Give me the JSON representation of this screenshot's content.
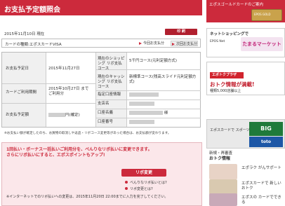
{
  "page": {
    "title": "お支払予定額照会",
    "date_text": "2015年11月10日 現在",
    "print_button": "印 刷",
    "card_type": "カードの種類:エポスカードVISA",
    "tab_current": "今回お支払分",
    "tab_next": "次回お支払分"
  },
  "info": {
    "due_date_label": "お支払予定日",
    "due_date_value": "2015年11月27日",
    "usage_period_label": "カードご利用期間",
    "usage_period_value": "2015年10月27日 まで ご利用分",
    "amount_label": "お支払予定額",
    "amount_suffix": "円(確定)",
    "shopping_course_label": "現在のショッピング リボ支払コース",
    "shopping_course_value": "5千円コース(元利定額方式)",
    "cashing_course_label": "現在のキャッシング リボ支払コース",
    "cashing_course_value": "新標準コース(残高スライド元利定額方式)",
    "bank_label": "指定口座情報",
    "branch_label": "支店名",
    "account_name_label": "口座名義",
    "account_name_suffix": "様",
    "account_number_label": "口座番号"
  },
  "note": "※お支払い額が確定したのち、お買物の取消しや返品・リボコース変更等があった場合は、お支払額が変わります。",
  "promo": {
    "text": "1回払い・ボーナス一括払いご利用分を、べんりなリボ払いに変更できます。さらにリボ払いにすると、エポスポイントもアップ!",
    "button": "リボ変更",
    "link1": "べんりなリボ払いとは?",
    "link2": "リボ変更とは?",
    "deadline_note": "※インターネットでのリボ払いへの変更は、2015年11月20日 22:00までに入力を完了してください。"
  },
  "sidebar": {
    "gold_text": "エポスゴールドカードのご案内",
    "gold_card_label": "EPOS GOLD",
    "shopping_head": "ネットショッピングで",
    "eposnet_label": "EPOS Net",
    "tamaru": "たまるマーケット",
    "ecomark_head": "エポトクプラザ",
    "otoku": "おトク情報が満載!",
    "otoku_sub": "種類5,000店舗以上",
    "sports_text": "エポスカードで スポーツくじ(toto・BIG)",
    "big_logo": "BIG",
    "toto_logo": "toto",
    "new_head_small": "新規・再審査",
    "new_head": "おトク情報",
    "svc1": "エポラク がんサポート",
    "svc2": "エポスカードで 新しいおトク",
    "svc3": "エポスの カードでできる"
  },
  "colors": {
    "brand": "#cc2a3c",
    "pink": "#fbe7ea"
  }
}
